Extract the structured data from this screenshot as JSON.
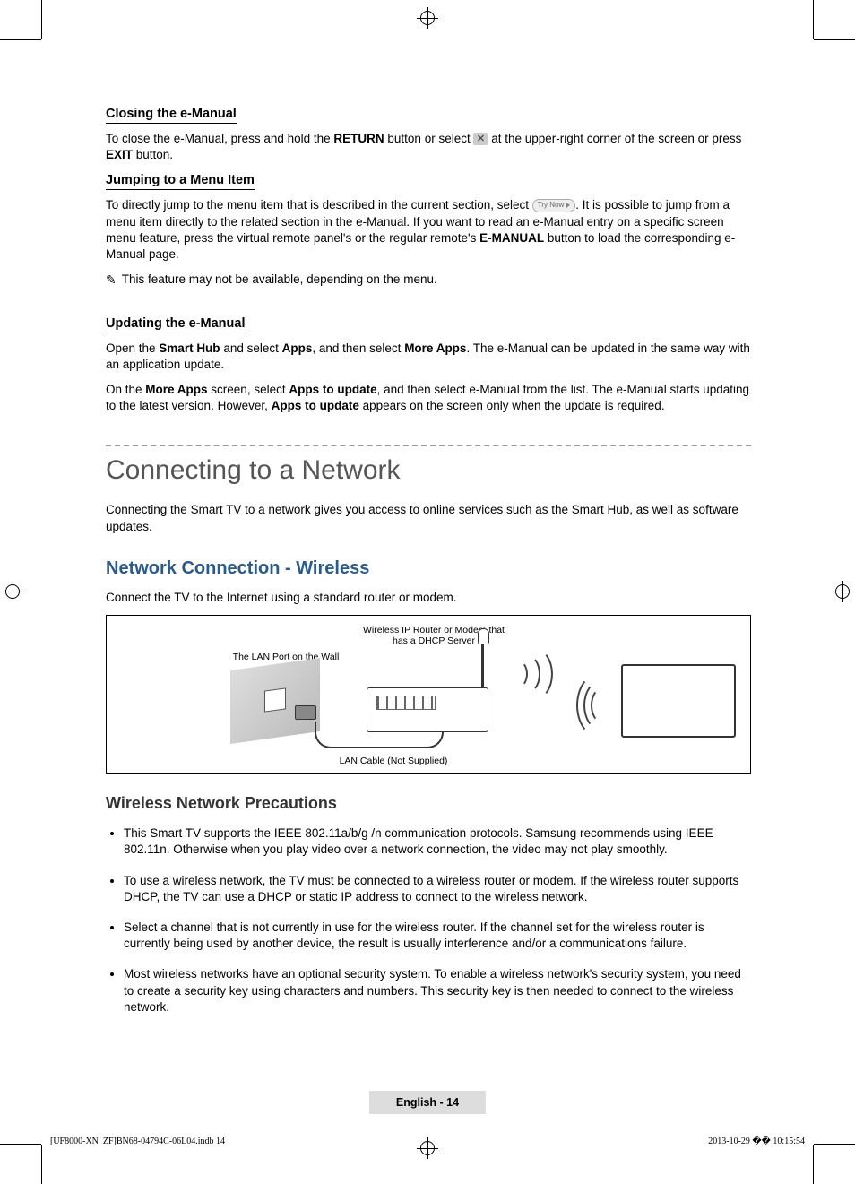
{
  "section1": {
    "title": "Closing the e-Manual",
    "p1a": "To close the e-Manual, press and hold the ",
    "return": "RETURN",
    "p1b": " button or select ",
    "p1c": " at the upper-right corner of the screen or press ",
    "exit": "EXIT",
    "p1d": " button."
  },
  "section2": {
    "title": "Jumping to a Menu Item",
    "p1a": "To directly jump to the menu item that is described in the current section, select ",
    "trynow": "Try Now",
    "p1b": ". It is possible to jump from a menu item directly to the related section in the e-Manual. If you want to read an e-Manual entry on a specific screen menu feature, press the virtual remote panel's or the regular remote's ",
    "emanual": "E-MANUAL",
    "p1c": " button to load the corresponding e-Manual page.",
    "note": "This feature may not be available, depending on the menu."
  },
  "section3": {
    "title": "Updating the e-Manual",
    "p1a": "Open the ",
    "smarthub": "Smart Hub",
    "p1b": " and select ",
    "apps": "Apps",
    "p1c": ", and then select ",
    "moreapps": "More Apps",
    "p1d": ". The e-Manual can be updated in the same way with an application update.",
    "p2a": "On the ",
    "p2b": " screen, select ",
    "appsupdate": "Apps to update",
    "p2c": ", and then select e-Manual from the list. The e-Manual starts updating to the latest version. However, ",
    "p2d": " appears on the screen only when the update is required."
  },
  "network": {
    "heading": "Connecting to a Network",
    "intro": "Connecting the Smart TV to a network gives you access to online services such as the Smart Hub, as well as software updates.",
    "wireless_h": "Network Connection - Wireless",
    "wireless_p": "Connect the TV to the Internet using a standard router or modem.",
    "diagram": {
      "router": "Wireless IP Router or Modem that has a DHCP Server",
      "wall": "The LAN Port on the Wall",
      "cable": "LAN Cable (Not Supplied)"
    },
    "precautions_h": "Wireless Network Precautions",
    "bullets": [
      "This Smart TV supports the IEEE 802.11a/b/g /n communication protocols. Samsung recommends using IEEE 802.11n. Otherwise when you play video over a network connection, the video may not play smoothly.",
      "To use a wireless network, the TV must be connected to a wireless router or modem. If the wireless router supports DHCP, the TV can use a DHCP or static IP address to connect to the wireless network.",
      "Select a channel that is not currently in use for the wireless router. If the channel set for the wireless router is currently being used by another device, the result is usually interference and/or a communications failure.",
      "Most wireless networks have an optional security system. To enable a wireless network's security system, you need to create a security key using characters and numbers. This security key is then needed to connect to the wireless network."
    ]
  },
  "footer": {
    "lang_page": "English - 14",
    "print_left": "[UF8000-XN_ZF]BN68-04794C-06L04.indb   14",
    "print_right": "2013-10-29   �� 10:15:54"
  }
}
